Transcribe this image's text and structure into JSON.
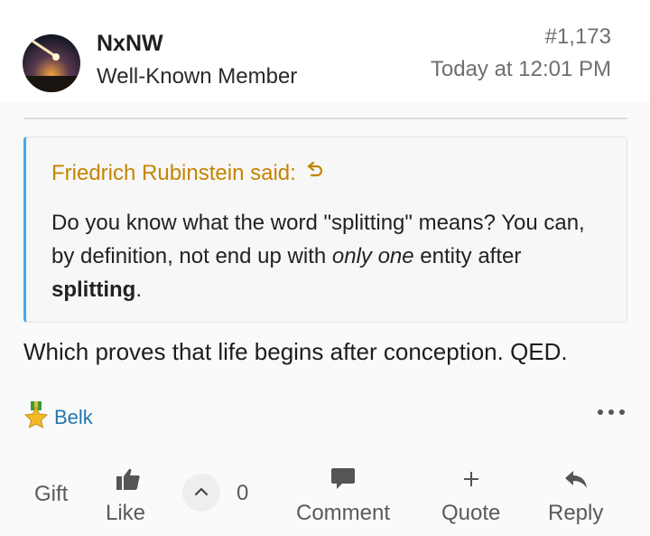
{
  "post": {
    "author": "NxNW",
    "author_title": "Well-Known Member",
    "number": "#1,173",
    "time": "Today at 12:01 PM"
  },
  "quote": {
    "attribution": "Friedrich Rubinstein said:",
    "text_1": "Do you know what the word \"splitting\" means? You can, by definition, not end up with ",
    "text_italic": "only one",
    "text_2": " entity after ",
    "text_bold": "splitting",
    "text_3": "."
  },
  "body": "Which proves that life begins after conception. QED.",
  "reaction": {
    "icon": "gold-star-medal-icon",
    "name": "Belk"
  },
  "actions": {
    "gift": "Gift",
    "like": "Like",
    "vote_count": "0",
    "comment": "Comment",
    "quote": "Quote",
    "reply": "Reply"
  },
  "colors": {
    "quote_border": "#47a7eb",
    "quote_attribution": "#c58400",
    "reaction_link": "#2577b1"
  }
}
